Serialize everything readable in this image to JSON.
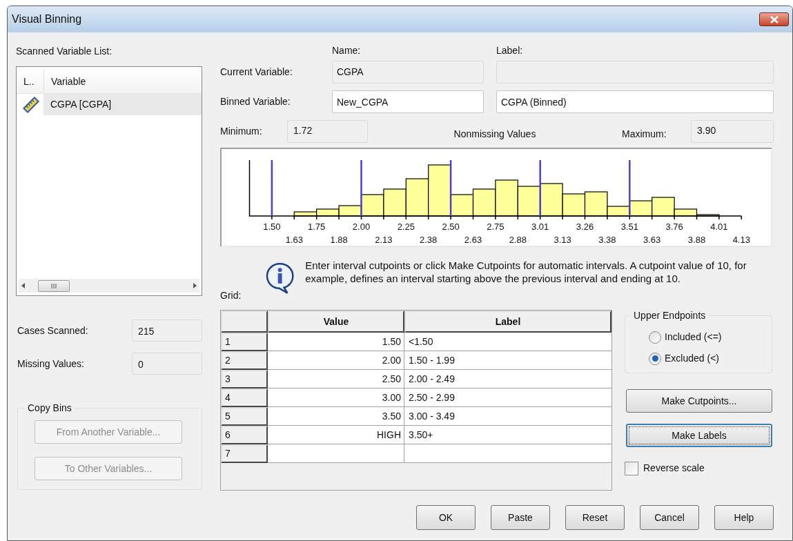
{
  "window": {
    "title": "Visual Binning"
  },
  "scanned_list": {
    "label": "Scanned Variable List:",
    "columns": [
      "L..",
      "Variable"
    ],
    "items": [
      {
        "name": "CGPA [CGPA]",
        "selected": true
      }
    ]
  },
  "cases_scanned": {
    "label": "Cases Scanned:",
    "value": "215"
  },
  "missing_values": {
    "label": "Missing Values:",
    "value": "0"
  },
  "copy_bins": {
    "title": "Copy Bins",
    "buttons": [
      {
        "label": "From Another Variable...",
        "disabled": true
      },
      {
        "label": "To Other Variables...",
        "disabled": true
      }
    ]
  },
  "headers": {
    "name": "Name:",
    "label": "Label:"
  },
  "current_variable": {
    "label": "Current Variable:",
    "name": "CGPA",
    "read_only": true
  },
  "binned_variable": {
    "label": "Binned Variable:",
    "name": "New_CGPA",
    "var_label": "CGPA (Binned)"
  },
  "minimum": {
    "label": "Minimum:",
    "value": "1.72"
  },
  "histogram_title": "Nonmissing Values",
  "maximum": {
    "label": "Maximum:",
    "value": "3.90"
  },
  "histogram": {
    "upper_ticks": [
      "1.50",
      "1.75",
      "2.00",
      "2.25",
      "2.50",
      "2.75",
      "3.01",
      "3.26",
      "3.51",
      "3.76",
      "4.01"
    ],
    "lower_ticks": [
      "1.63",
      "1.88",
      "2.13",
      "2.38",
      "2.63",
      "2.88",
      "3.13",
      "3.38",
      "3.63",
      "3.88",
      "4.13"
    ]
  },
  "info_text": "Enter interval cutpoints or click Make Cutpoints for automatic intervals.  A cutpoint value of 10, for example, defines an interval starting above the previous interval and ending at 10.",
  "grid": {
    "label": "Grid:",
    "columns": [
      "Value",
      "Label"
    ],
    "rows": [
      {
        "number": "1",
        "value": "1.50",
        "label": "<1.50"
      },
      {
        "number": "2",
        "value": "2.00",
        "label": "1.50 - 1.99"
      },
      {
        "number": "3",
        "value": "2.50",
        "label": "2.00 - 2.49"
      },
      {
        "number": "4",
        "value": "3.00",
        "label": "2.50 - 2.99"
      },
      {
        "number": "5",
        "value": "3.50",
        "label": "3.00 - 3.49"
      },
      {
        "number": "6",
        "value": "HIGH",
        "label": "3.50+"
      },
      {
        "number": "7"
      }
    ]
  },
  "upper_endpoints": {
    "title": "Upper Endpoints",
    "options": [
      {
        "label": "Included (<=)",
        "selected": false
      },
      {
        "label": "Excluded (<)",
        "selected": true
      }
    ]
  },
  "side_buttons": [
    {
      "label": "Make Cutpoints...",
      "focused": false
    },
    {
      "label": "Make Labels",
      "focused": true
    }
  ],
  "reverse_scale": {
    "label": "Reverse scale",
    "checked": false
  },
  "buttons": [
    {
      "label": "OK"
    },
    {
      "label": "Paste"
    },
    {
      "label": "Reset"
    },
    {
      "label": "Cancel"
    },
    {
      "label": "Help"
    }
  ]
}
